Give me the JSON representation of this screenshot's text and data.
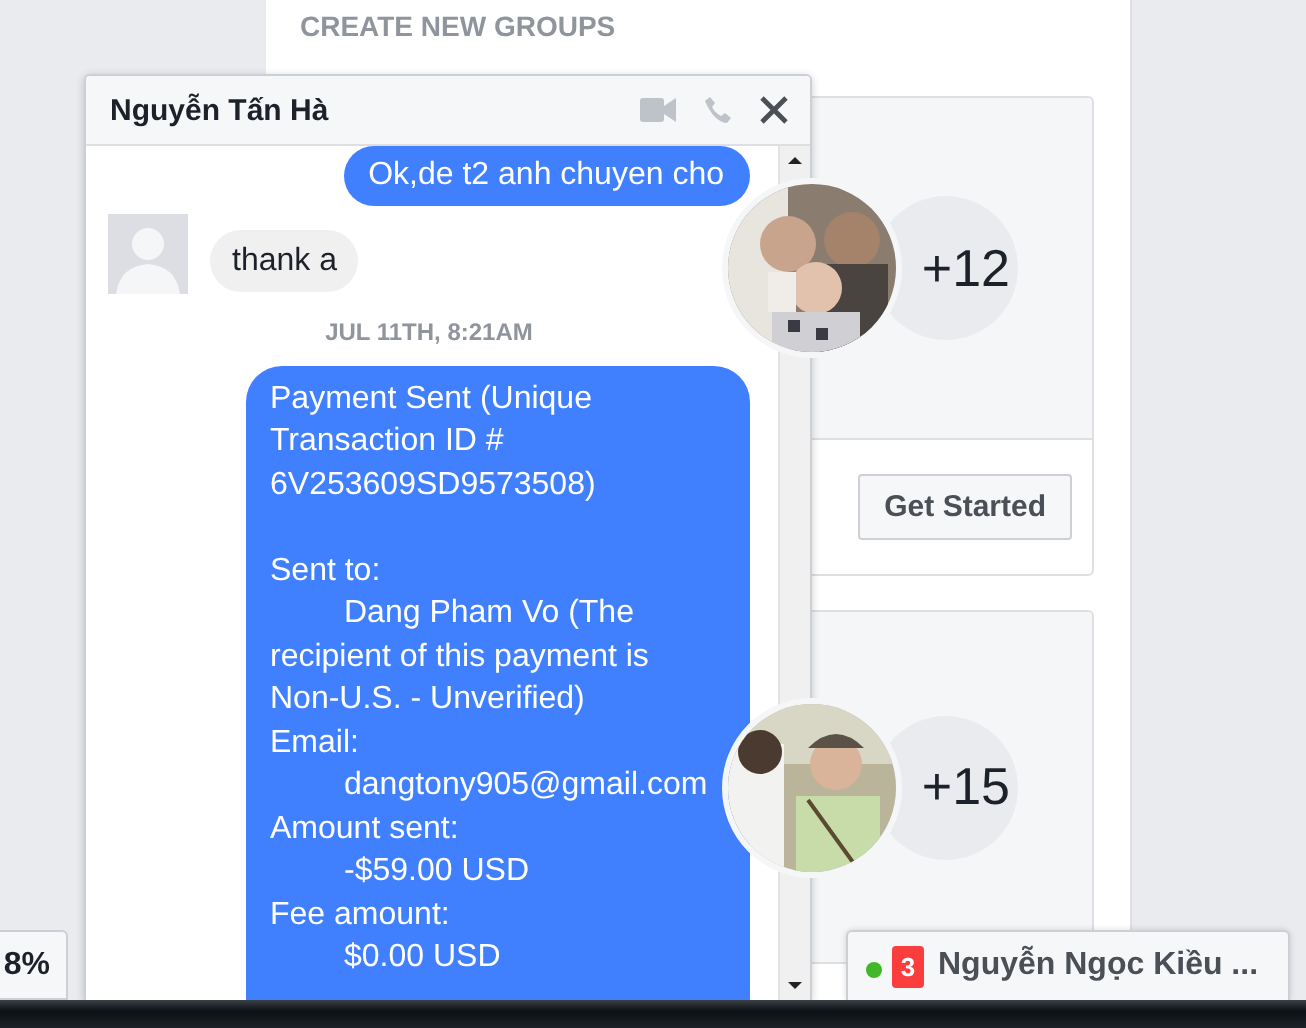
{
  "page": {
    "section_title": "CREATE NEW GROUPS",
    "group_cards": [
      {
        "count": "+12",
        "button": "Get Started"
      },
      {
        "count": "+15"
      }
    ],
    "left_tab": {
      "label": "8%"
    }
  },
  "chat": {
    "title": "Nguyễn Tấn Hà",
    "messages": [
      {
        "kind": "outgoing",
        "text": "Ok,de t2 anh chuyen cho"
      },
      {
        "kind": "incoming",
        "text": "thank a"
      },
      {
        "kind": "timestamp",
        "text": "JUL 11TH, 8:21AM"
      },
      {
        "kind": "outgoing",
        "text": "Payment Sent (Unique Transaction ID # 6V253609SD9573508)\n\nSent to:\n\tDang Pham Vo (The recipient of this payment is Non-U.S. - Unverified)\nEmail:\n\tdangtony905@gmail.com\nAmount sent:\n\t-$59.00 USD\nFee amount:\n\t$0.00 USD"
      }
    ]
  },
  "chat_tab": {
    "name": "Nguyễn Ngọc Kiều ...",
    "unread": "3",
    "online": true
  }
}
